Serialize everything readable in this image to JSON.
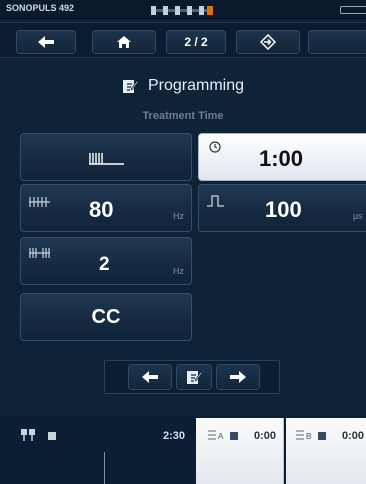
{
  "status": {
    "device_name": "SONOPULS 492"
  },
  "nav": {
    "page_indicator": "2 / 2"
  },
  "header": {
    "title": "Programming",
    "subtitle": "Treatment Time"
  },
  "params": {
    "time": "1:00",
    "frequency": {
      "value": "80",
      "unit": "Hz"
    },
    "pulse": {
      "value": "100",
      "unit": "µs"
    },
    "burst": {
      "value": "2",
      "unit": "Hz"
    },
    "mode": "CC"
  },
  "bottom": {
    "total_time": "2:30",
    "channel_a": {
      "label": "A",
      "time": "0:00"
    },
    "channel_b": {
      "label": "B",
      "time": "0:00"
    }
  },
  "colors": {
    "background": "#0e2238",
    "accent": "#e07010"
  }
}
